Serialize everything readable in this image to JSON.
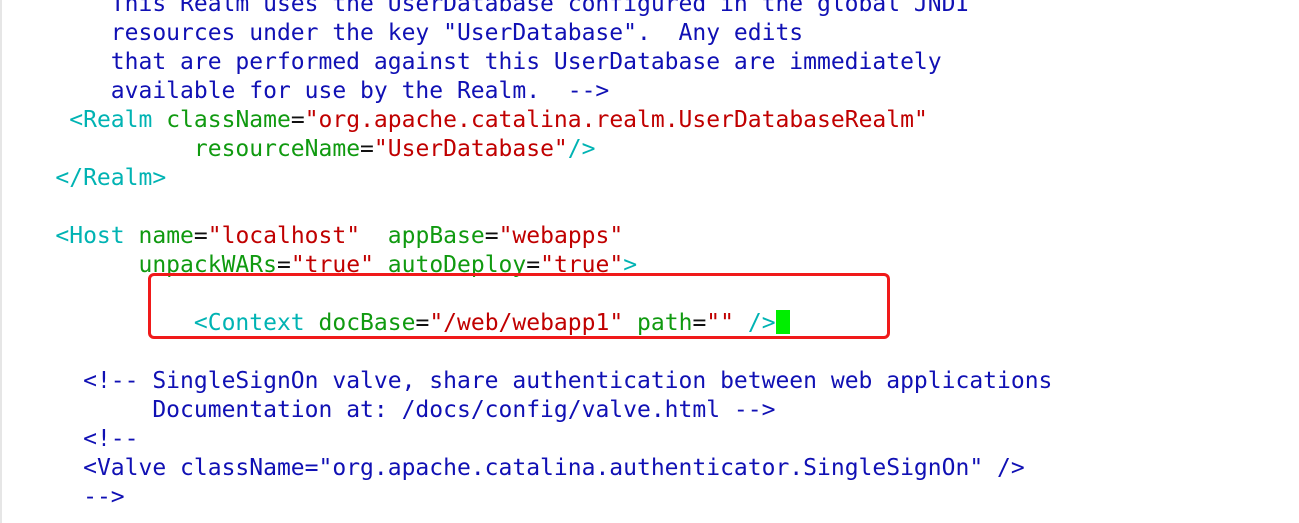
{
  "editor": {
    "lines": [
      {
        "indent": "   ",
        "segments": [
          {
            "t": "cm",
            "text": "     This Realm uses the UserDatabase configured in the global JNDI"
          }
        ]
      },
      {
        "indent": "",
        "segments": [
          {
            "t": "cm",
            "text": "        resources under the key \"UserDatabase\".  Any edits"
          }
        ]
      },
      {
        "indent": "",
        "segments": [
          {
            "t": "cm",
            "text": "        that are performed against this UserDatabase are immediately"
          }
        ]
      },
      {
        "indent": "",
        "segments": [
          {
            "t": "cm",
            "text": "        available for use by the Realm.  -->"
          }
        ]
      },
      {
        "indent": "     ",
        "segments": [
          {
            "t": "tg",
            "text": "<Realm"
          },
          {
            "t": "eq",
            "text": " "
          },
          {
            "t": "at",
            "text": "className"
          },
          {
            "t": "eq",
            "text": "="
          },
          {
            "t": "vl",
            "text": "\"org.apache.catalina.realm.UserDatabaseRealm\""
          }
        ]
      },
      {
        "indent": "              ",
        "segments": [
          {
            "t": "at",
            "text": "resourceName"
          },
          {
            "t": "eq",
            "text": "="
          },
          {
            "t": "vl",
            "text": "\"UserDatabase\""
          },
          {
            "t": "tg",
            "text": "/>"
          }
        ]
      },
      {
        "indent": "    ",
        "segments": [
          {
            "t": "tg",
            "text": "</Realm>"
          }
        ]
      },
      {
        "indent": "",
        "segments": []
      },
      {
        "indent": "    ",
        "segments": [
          {
            "t": "tg",
            "text": "<Host"
          },
          {
            "t": "eq",
            "text": " "
          },
          {
            "t": "at",
            "text": "name"
          },
          {
            "t": "eq",
            "text": "="
          },
          {
            "t": "vl",
            "text": "\"localhost\""
          },
          {
            "t": "eq",
            "text": "  "
          },
          {
            "t": "at",
            "text": "appBase"
          },
          {
            "t": "eq",
            "text": "="
          },
          {
            "t": "vl",
            "text": "\"webapps\""
          }
        ]
      },
      {
        "indent": "          ",
        "segments": [
          {
            "t": "at",
            "text": "unpackWARs"
          },
          {
            "t": "eq",
            "text": "="
          },
          {
            "t": "vl",
            "text": "\"true\""
          },
          {
            "t": "eq",
            "text": " "
          },
          {
            "t": "at",
            "text": "autoDeploy"
          },
          {
            "t": "eq",
            "text": "="
          },
          {
            "t": "vl",
            "text": "\"true\""
          },
          {
            "t": "tg",
            "text": ">"
          }
        ]
      },
      {
        "indent": "",
        "segments": []
      },
      {
        "indent": "              ",
        "segments": [
          {
            "t": "tg",
            "text": "<Context"
          },
          {
            "t": "eq",
            "text": " "
          },
          {
            "t": "at",
            "text": "docBase"
          },
          {
            "t": "eq",
            "text": "="
          },
          {
            "t": "vl",
            "text": "\"/web/webapp1\""
          },
          {
            "t": "eq",
            "text": " "
          },
          {
            "t": "at",
            "text": "path"
          },
          {
            "t": "eq",
            "text": "="
          },
          {
            "t": "vl",
            "text": "\"\""
          },
          {
            "t": "eq",
            "text": " "
          },
          {
            "t": "tg",
            "text": "/>"
          }
        ],
        "cursor": true
      },
      {
        "indent": "",
        "segments": []
      },
      {
        "indent": "      ",
        "segments": [
          {
            "t": "cm",
            "text": "<!-- SingleSignOn valve, share authentication between web applications"
          }
        ]
      },
      {
        "indent": "           ",
        "segments": [
          {
            "t": "cm",
            "text": "Documentation at: /docs/config/valve.html -->"
          }
        ]
      },
      {
        "indent": "      ",
        "segments": [
          {
            "t": "cm",
            "text": "<!--"
          }
        ]
      },
      {
        "indent": "      ",
        "segments": [
          {
            "t": "cm",
            "text": "<Valve className=\"org.apache.catalina.authenticator.SingleSignOn\" />"
          }
        ]
      },
      {
        "indent": "      ",
        "segments": [
          {
            "t": "cm",
            "text": "-->"
          }
        ]
      }
    ],
    "colors": {
      "comment": "#1010b4",
      "tag": "#00b3b3",
      "attribute": "#109a10",
      "value": "#c00000",
      "cursor": "#00ee00",
      "highlight_box": "#f01a1a"
    }
  }
}
